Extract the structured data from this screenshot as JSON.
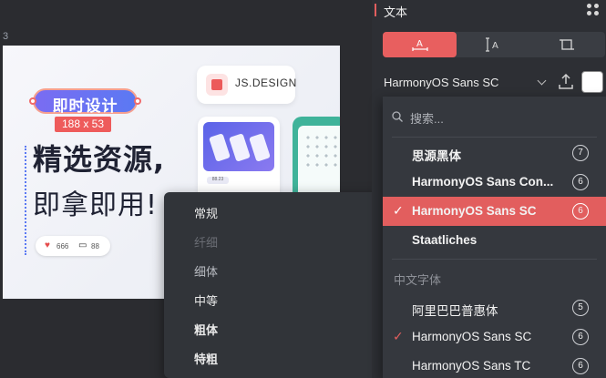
{
  "canvas": {
    "frame_number": "3",
    "tag_text": "即时设计",
    "size_badge": "188 x 53",
    "headline_line1": "精选资源,",
    "headline_line2": "即拿即用!",
    "likes": "666",
    "comments": "88",
    "brand_card": "JS.DESIGN",
    "chip_text": "88.23"
  },
  "weight_menu": {
    "items": [
      {
        "label": "常规",
        "state": "normal"
      },
      {
        "label": "纤细",
        "state": "disabled"
      },
      {
        "label": "细体",
        "state": "muted"
      },
      {
        "label": "中等",
        "state": "normal"
      },
      {
        "label": "粗体",
        "state": "bold"
      },
      {
        "label": "特粗",
        "state": "bold"
      }
    ]
  },
  "panel": {
    "title": "文本",
    "font_value": "HarmonyOS Sans SC",
    "swatch_color": "#ffffff",
    "accent_color": "#e25e5e"
  },
  "font_dropdown": {
    "search_placeholder": "搜索...",
    "recent": [
      {
        "name": "思源黑体",
        "count": "7",
        "selected": false
      },
      {
        "name": "HarmonyOS Sans Con...",
        "count": "6",
        "selected": false
      },
      {
        "name": "HarmonyOS Sans SC",
        "count": "6",
        "selected": true
      },
      {
        "name": "Staatliches",
        "count": "",
        "selected": false
      }
    ],
    "group_label": "中文字体",
    "chinese_fonts": [
      {
        "name": "阿里巴巴普惠体",
        "count": "5",
        "checked": false
      },
      {
        "name": "HarmonyOS Sans SC",
        "count": "6",
        "checked": true
      },
      {
        "name": "HarmonyOS Sans TC",
        "count": "6",
        "checked": false
      }
    ]
  }
}
